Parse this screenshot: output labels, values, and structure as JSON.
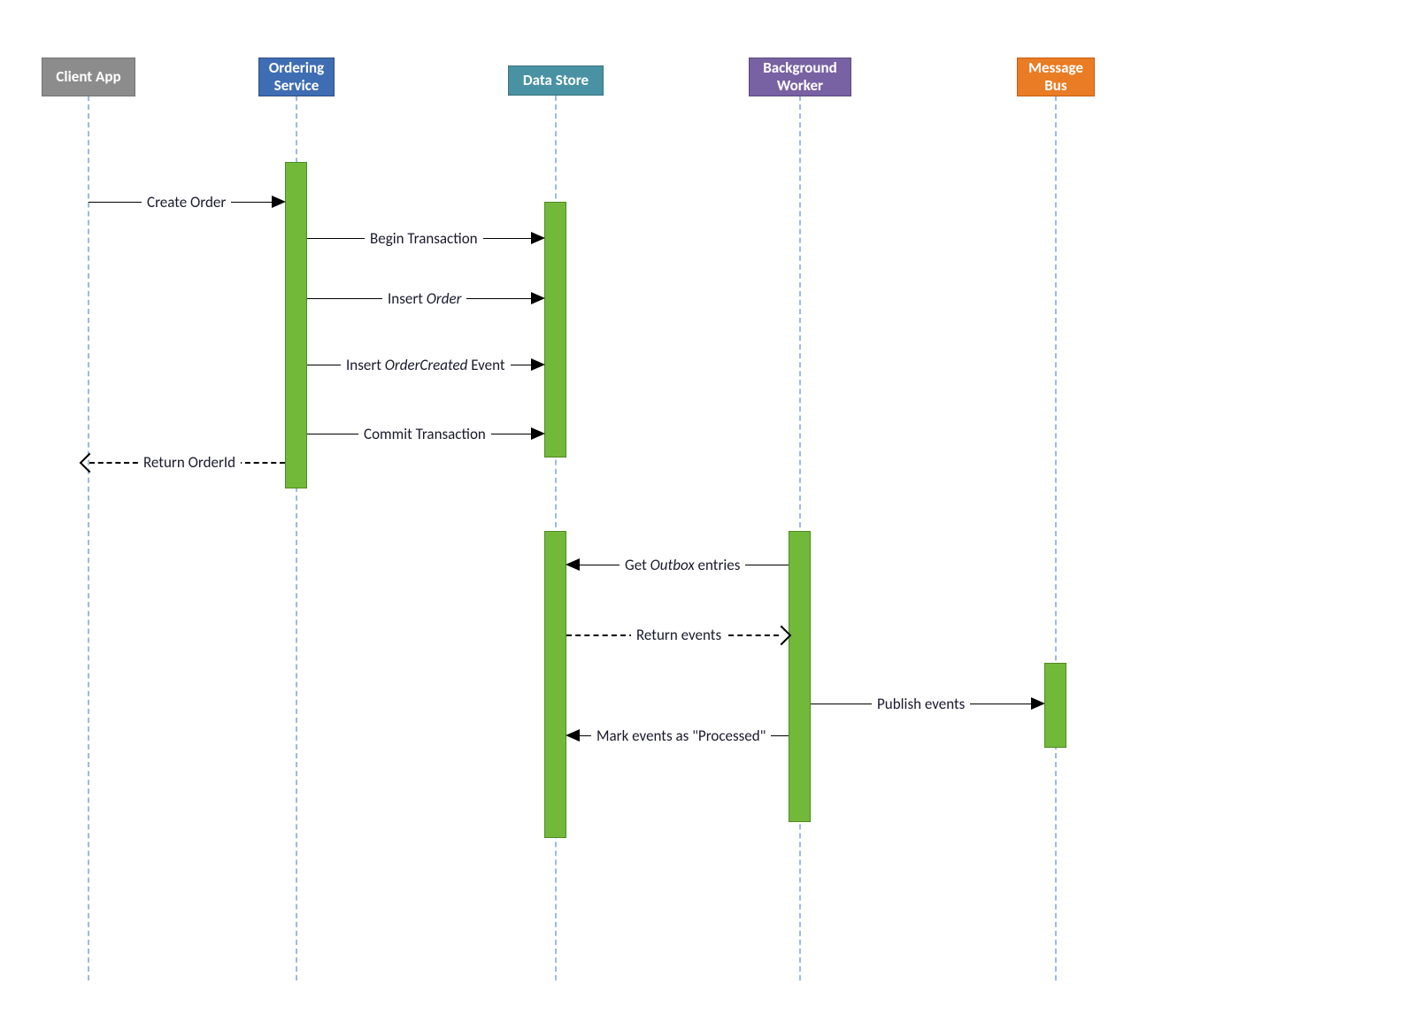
{
  "participants": {
    "client": "Client App",
    "ordering": "Ordering Service",
    "datastore": "Data Store",
    "worker": "Background Worker",
    "bus": "Message Bus"
  },
  "messages": {
    "createOrder": "Create Order",
    "beginTx": "Begin Transaction",
    "insertOrderPre": "Insert ",
    "insertOrderItal": "Order",
    "insertEvtPre": "Insert ",
    "insertEvtItal": "OrderCreated",
    "insertEvtPost": " Event",
    "commitTx": "Commit Transaction",
    "returnId": "Return OrderId",
    "getOutboxPre": "Get ",
    "getOutboxItal": "Outbox",
    "getOutboxPost": " entries",
    "returnEvents": "Return events",
    "publish": "Publish events",
    "mark": "Mark events as \"Processed\""
  }
}
